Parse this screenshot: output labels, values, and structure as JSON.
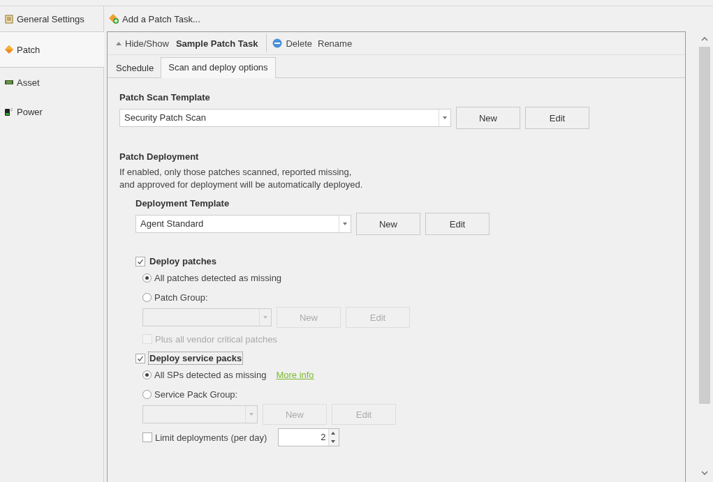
{
  "sidebar": {
    "items": [
      {
        "label": "General Settings",
        "selected": false
      },
      {
        "label": "Patch",
        "selected": true
      },
      {
        "label": "Asset",
        "selected": false
      },
      {
        "label": "Power",
        "selected": false
      }
    ]
  },
  "toolbar": {
    "add_button": "Add a Patch Task..."
  },
  "task": {
    "toggle": "Hide/Show",
    "name": "Sample Patch Task",
    "delete": "Delete",
    "rename": "Rename"
  },
  "tabs": [
    {
      "label": "Schedule",
      "selected": false
    },
    {
      "label": "Scan and deploy options",
      "selected": true
    }
  ],
  "scan_template": {
    "heading": "Patch Scan Template",
    "value": "Security Patch Scan",
    "new": "New",
    "edit": "Edit"
  },
  "deployment": {
    "heading": "Patch Deployment",
    "description": "If enabled, only those patches scanned, reported missing,\nand approved for deployment will be automatically deployed.",
    "template": {
      "heading": "Deployment Template",
      "value": "Agent Standard",
      "new": "New",
      "edit": "Edit"
    },
    "deploy_patches": {
      "label": "Deploy patches",
      "checked": true,
      "options": [
        {
          "label": "All patches detected as missing",
          "selected": true
        },
        {
          "label": "Patch Group:",
          "selected": false
        }
      ],
      "group": {
        "disabled": true,
        "new": "New",
        "edit": "Edit"
      },
      "vendor_critical": {
        "label": "Plus all vendor critical patches",
        "checked": false,
        "disabled": true
      }
    },
    "deploy_service_packs": {
      "label": "Deploy service packs",
      "checked": true,
      "focused": true,
      "options": [
        {
          "label": "All SPs detected as missing",
          "selected": true,
          "link": "More info"
        },
        {
          "label": "Service Pack Group:",
          "selected": false
        }
      ],
      "group": {
        "disabled": true,
        "new": "New",
        "edit": "Edit"
      }
    },
    "limit": {
      "label": "Limit deployments (per day)",
      "checked": false,
      "value": "2"
    }
  }
}
